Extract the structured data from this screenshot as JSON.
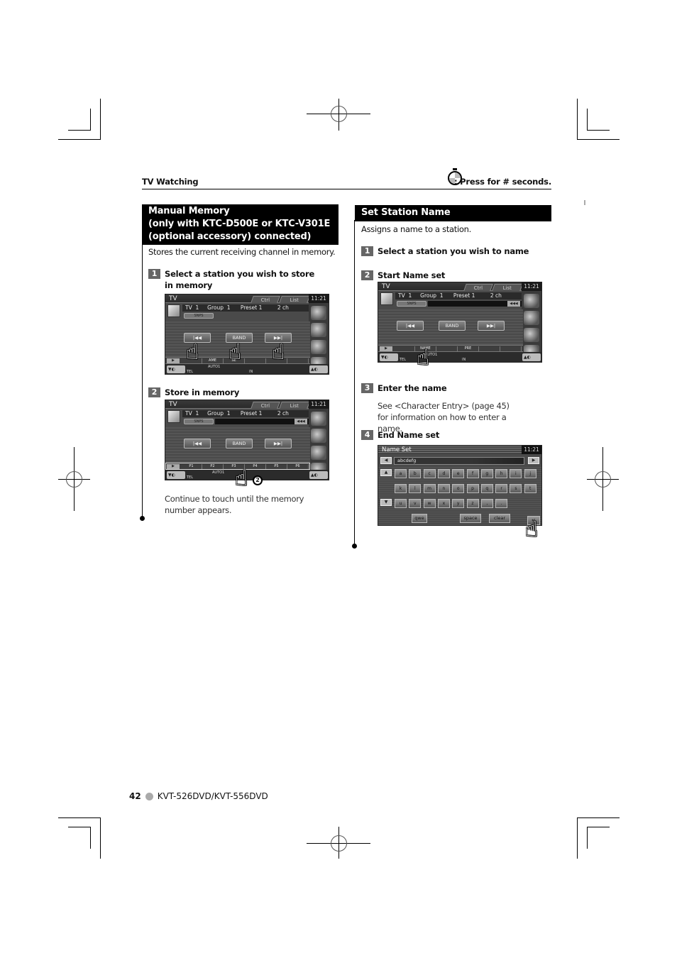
{
  "header": {
    "section": "TV Watching",
    "legend_icon": "stopwatch-icon",
    "legend_text": ": Press for # seconds."
  },
  "left": {
    "title_lines": [
      "Manual Memory",
      "(only with KTC-D500E or KTC-V301E",
      "(optional accessory) connected)"
    ],
    "description": "Stores the current receiving channel in memory.",
    "steps": [
      {
        "num": "1",
        "text": "Select a station you wish to store in memory"
      },
      {
        "num": "2",
        "text": "Store in memory"
      }
    ],
    "note": "Continue to touch until the memory number appears."
  },
  "right": {
    "title": "Set Station Name",
    "description": "Assigns a name to a station.",
    "steps": [
      {
        "num": "1",
        "text": "Select a station you wish to name"
      },
      {
        "num": "2",
        "text": "Start Name set"
      },
      {
        "num": "3",
        "text": "Enter the name"
      },
      {
        "num": "4",
        "text": "End Name set"
      }
    ],
    "note": "See <Character Entry> (page 45) for information on how to enter a name."
  },
  "screen": {
    "title": "TV",
    "tabs": [
      "Ctrl",
      "List"
    ],
    "clock": "11:21",
    "info": "TV  1     Group  1      Preset 1         2 ch",
    "snps": "SNPS",
    "rew": "◀◀◀",
    "buttons": [
      "|◀◀",
      "BAND",
      "▶▶|"
    ],
    "play": "▶",
    "status": {
      "auto": "AUTO1",
      "tel": "TEL",
      "in": "IN"
    },
    "screen1_slots": [
      "",
      "AME",
      "SE",
      "",
      "",
      ""
    ],
    "screen2_slots": [
      "P1",
      "P2",
      "P3",
      "P4",
      "P5",
      "P6"
    ],
    "screen3_slots": [
      "",
      "NAME",
      "",
      "PRE",
      "",
      ""
    ],
    "callout_number": "2"
  },
  "keyboard": {
    "title": "Name Set",
    "clock": "11:21",
    "value": "abcdefg",
    "row1": [
      "a",
      "b",
      "c",
      "d",
      "e",
      "f",
      "g",
      "h",
      "i",
      "j"
    ],
    "row2": [
      "k",
      "l",
      "m",
      "n",
      "o",
      "p",
      "q",
      "r",
      "s",
      "t"
    ],
    "row3": [
      "u",
      "v",
      "w",
      "x",
      "y",
      "z",
      ",",
      "."
    ],
    "qwe": "qwe",
    "space": "space",
    "clear": "clear",
    "enter": "↵"
  },
  "footer": {
    "page": "42",
    "model": "KVT-526DVD/KVT-556DVD"
  }
}
